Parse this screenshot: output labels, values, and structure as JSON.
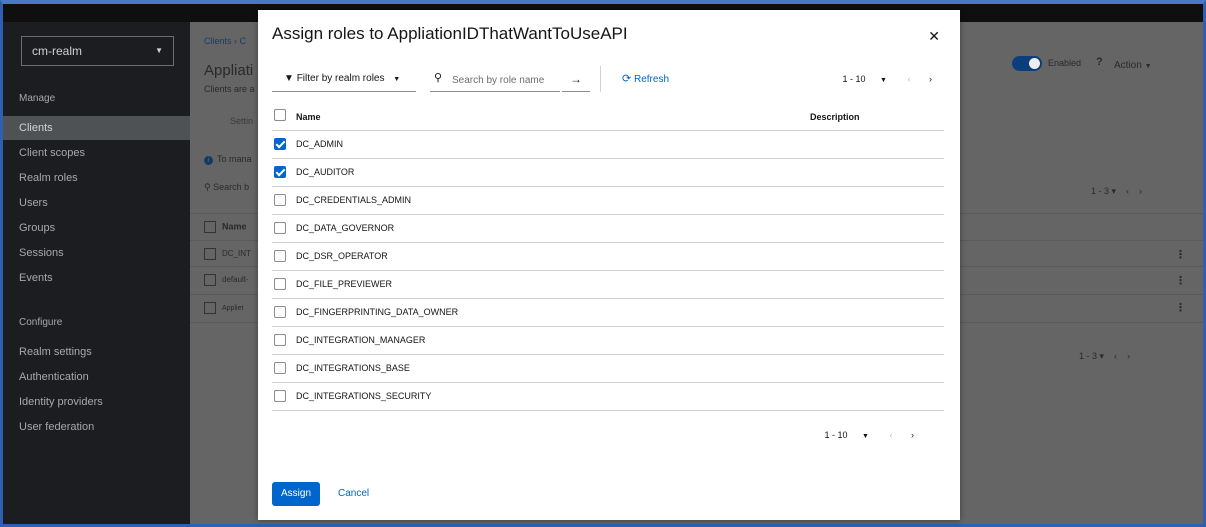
{
  "sidebar": {
    "realm": "cm-realm",
    "sections": {
      "manage": "Manage",
      "configure": "Configure"
    },
    "items": [
      {
        "label": "Clients",
        "active": true
      },
      {
        "label": "Client scopes"
      },
      {
        "label": "Realm roles"
      },
      {
        "label": "Users"
      },
      {
        "label": "Groups"
      },
      {
        "label": "Sessions"
      },
      {
        "label": "Events"
      }
    ],
    "config_items": [
      {
        "label": "Realm settings"
      },
      {
        "label": "Authentication"
      },
      {
        "label": "Identity providers"
      },
      {
        "label": "User federation"
      }
    ]
  },
  "background": {
    "breadcrumb": "Clients ›  C",
    "title": "Appliati",
    "subtitle": "Clients are a",
    "tab": "Settin",
    "info": "To mana",
    "search": "Search b",
    "name_header": "Name",
    "rows": [
      "DC_INT",
      "default-",
      "Appliet"
    ],
    "enabled_label": "Enabled",
    "action_label": "Action",
    "pager": "1 - 3"
  },
  "modal": {
    "title": "Assign roles to AppliationIDThatWantToUseAPI",
    "filter_label": "Filter by realm roles",
    "search_placeholder": "Search by role name",
    "refresh_label": "Refresh",
    "pager_range": "1 - 10",
    "columns": {
      "name": "Name",
      "description": "Description"
    },
    "roles": [
      {
        "name": "DC_ADMIN",
        "checked": true
      },
      {
        "name": "DC_AUDITOR",
        "checked": true
      },
      {
        "name": "DC_CREDENTIALS_ADMIN",
        "checked": false
      },
      {
        "name": "DC_DATA_GOVERNOR",
        "checked": false
      },
      {
        "name": "DC_DSR_OPERATOR",
        "checked": false
      },
      {
        "name": "DC_FILE_PREVIEWER",
        "checked": false
      },
      {
        "name": "DC_FINGERPRINTING_DATA_OWNER",
        "checked": false
      },
      {
        "name": "DC_INTEGRATION_MANAGER",
        "checked": false
      },
      {
        "name": "DC_INTEGRATIONS_BASE",
        "checked": false
      },
      {
        "name": "DC_INTEGRATIONS_SECURITY",
        "checked": false
      }
    ],
    "assign_label": "Assign",
    "cancel_label": "Cancel"
  }
}
